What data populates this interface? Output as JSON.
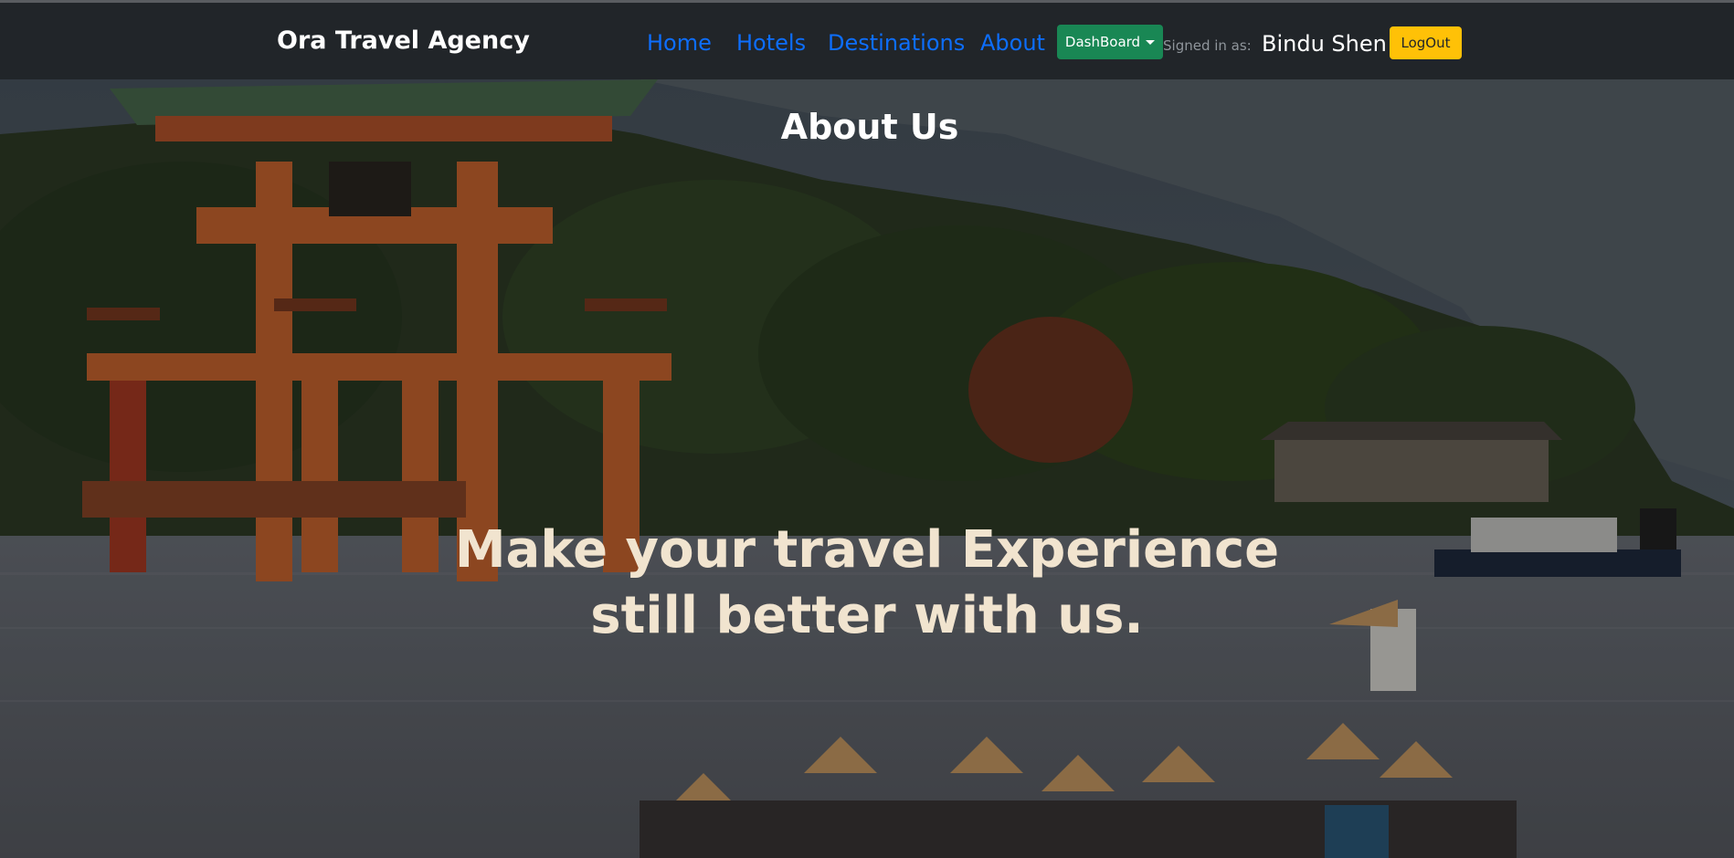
{
  "navbar": {
    "brand": "Ora Travel Agency",
    "links": [
      {
        "label": "Home"
      },
      {
        "label": "Hotels"
      },
      {
        "label": "Destinations"
      },
      {
        "label": "About"
      }
    ],
    "dashboard_label": "DashBoard",
    "signed_in_label": "Signed in as:",
    "user_name": "Bindu Shen",
    "logout_label": "LogOut"
  },
  "hero": {
    "title": "About Us",
    "tagline_line1": "Make your travel Experience",
    "tagline_line2": "still better with us."
  },
  "colors": {
    "navbar_bg": "#212529",
    "link": "#0d6efd",
    "dashboard_btn": "#198754",
    "logout_btn": "#ffc107",
    "tagline": "#f1e4cf"
  }
}
